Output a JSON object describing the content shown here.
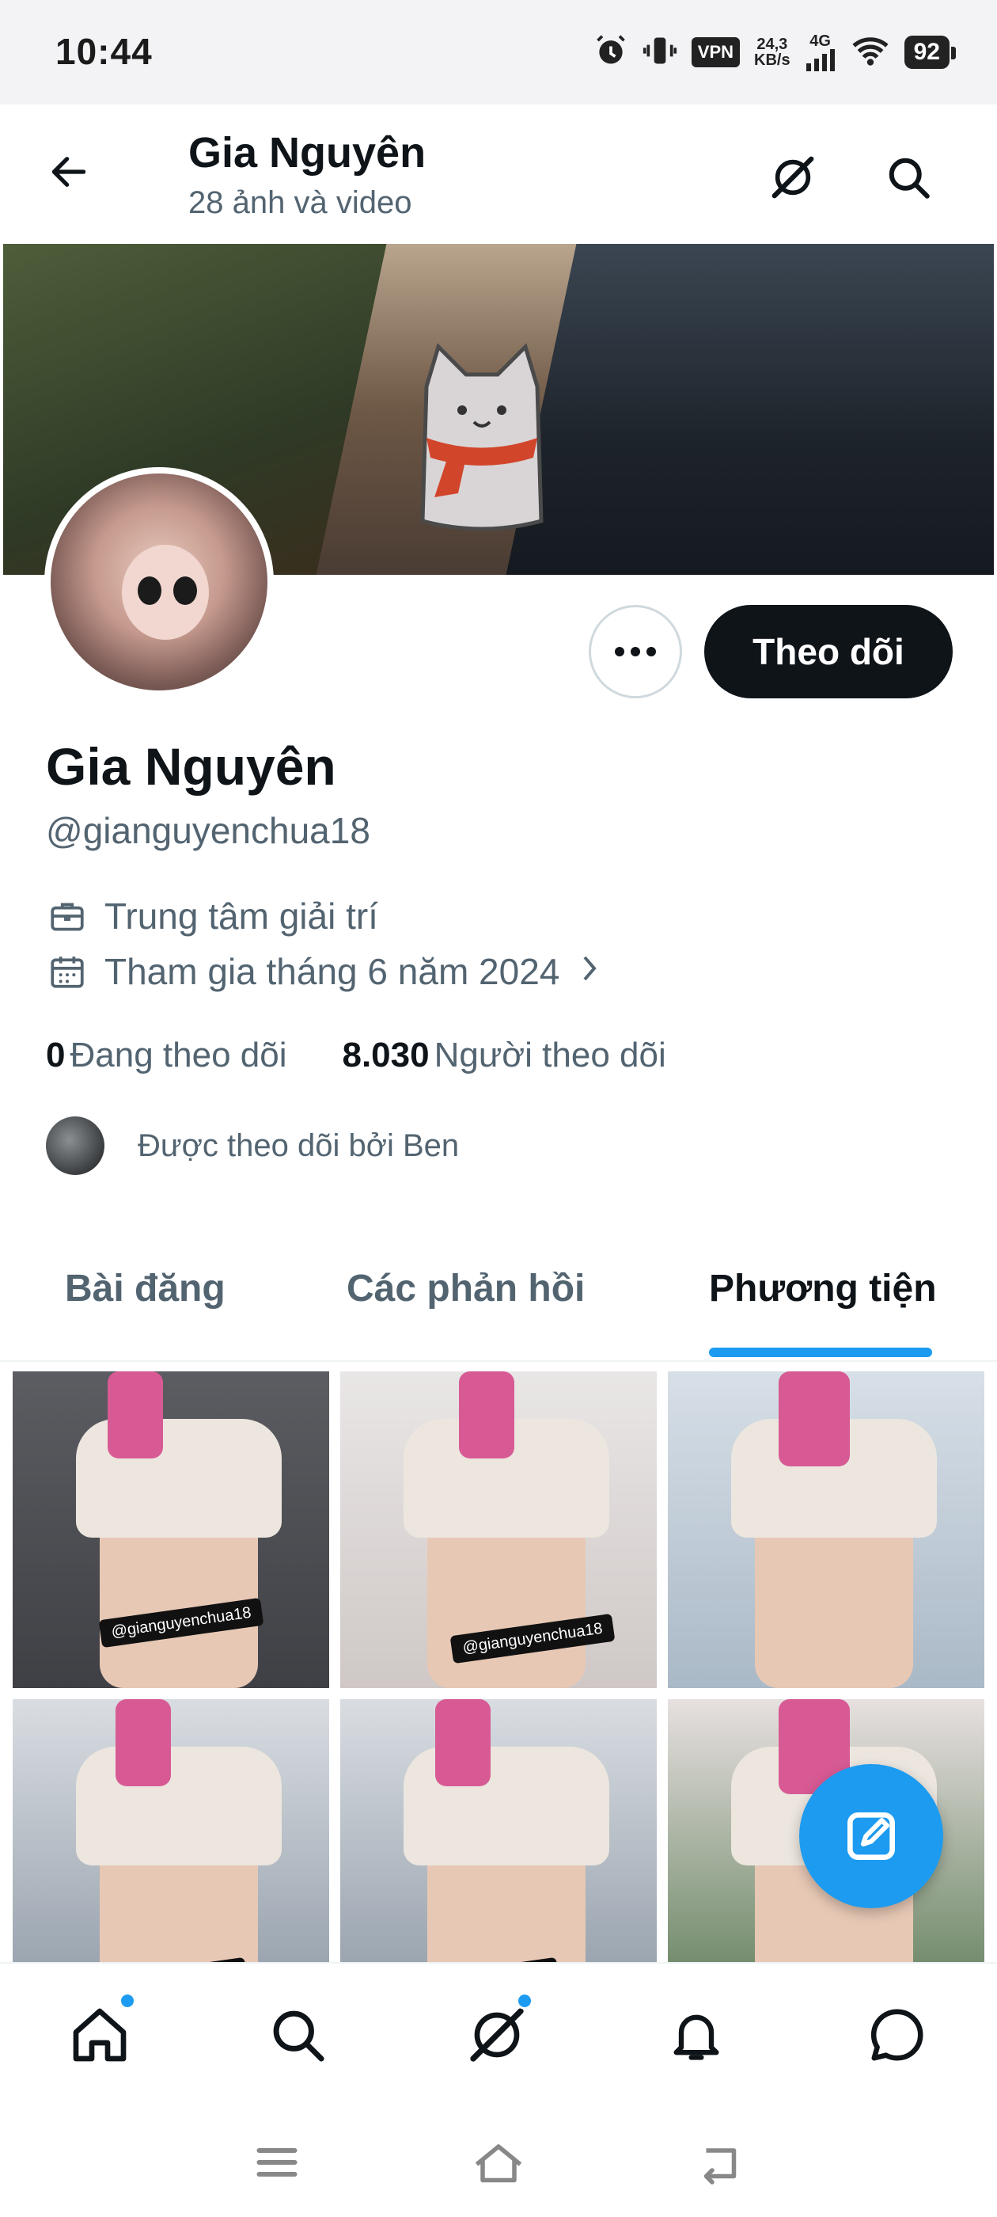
{
  "status_bar": {
    "time": "10:44",
    "vpn": "VPN",
    "speed_value": "24,3",
    "speed_unit": "KB/s",
    "network": "4G",
    "battery": "92"
  },
  "header": {
    "title": "Gia Nguyên",
    "subtitle": "28 ảnh và video"
  },
  "profile": {
    "name": "Gia Nguyên",
    "handle": "@gianguyenchua18",
    "category": "Trung tâm giải trí",
    "joined": "Tham gia tháng 6 năm 2024",
    "following_count": "0",
    "following_label": "Đang theo dõi",
    "followers_count": "8.030",
    "followers_label": "Người theo dõi",
    "followed_by": "Được theo dõi bởi Ben",
    "follow_button": "Theo dõi"
  },
  "tabs": [
    {
      "label": "Bài đăng",
      "active": false
    },
    {
      "label": "Các phản hồi",
      "active": false
    },
    {
      "label": "Phương tiện",
      "active": true
    }
  ],
  "media": {
    "watermark": "@gianguyenchua18"
  },
  "bottom_nav": [
    "home-icon",
    "search-icon",
    "grok-icon",
    "notifications-icon",
    "messages-icon"
  ],
  "colors": {
    "accent": "#1d9bf0",
    "text": "#0f1419",
    "secondary": "#536471",
    "button_dark": "#0f1419"
  }
}
